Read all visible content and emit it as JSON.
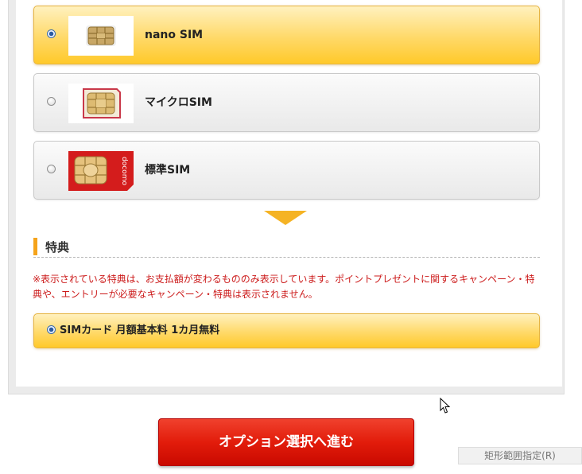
{
  "sim_options": [
    {
      "label": "nano SIM",
      "selected": true,
      "thumb_icon": "nano-sim-chip-icon"
    },
    {
      "label": "マイクロSIM",
      "selected": false,
      "thumb_icon": "micro-sim-card-icon"
    },
    {
      "label": "標準SIM",
      "selected": false,
      "thumb_icon": "standard-sim-card-icon",
      "thumb_text": "docomo"
    }
  ],
  "benefits": {
    "title": "特典",
    "notice": "※表示されている特典は、お支払額が変わるもののみ表示しています。ポイントプレゼントに関するキャンペーン・特典や、エントリーが必要なキャンペーン・特典は表示されません。",
    "items": [
      {
        "label": "SIMカード 月額基本料 1カ月無料",
        "selected": true
      }
    ]
  },
  "cta": {
    "label": "オプション選択へ進む"
  },
  "tooltip": {
    "label": "矩形範囲指定(R)"
  },
  "colors": {
    "selected_gradient_top": "#fff1bf",
    "selected_gradient_bottom": "#ffc92a",
    "accent_orange": "#f5a31a",
    "notice_red": "#cc1b1b",
    "cta_red": "#e21c0b"
  }
}
